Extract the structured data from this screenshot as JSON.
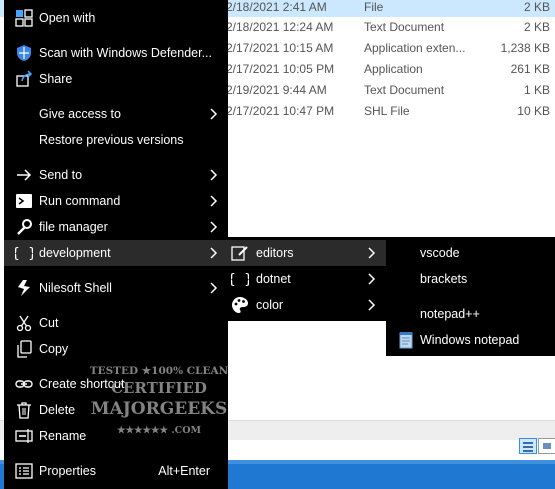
{
  "file_list": {
    "rows": [
      {
        "date": "2/18/2021 2:41 AM",
        "type": "File",
        "size": "2 KB",
        "selected": true
      },
      {
        "date": "2/18/2021 12:24 AM",
        "type": "Text Document",
        "size": "2 KB"
      },
      {
        "date": "2/17/2021 10:15 AM",
        "type": "Application exten...",
        "size": "1,238 KB"
      },
      {
        "date": "2/17/2021 10:05 PM",
        "type": "Application",
        "size": "261 KB"
      },
      {
        "date": "2/19/2021 9:44 AM",
        "type": "Text Document",
        "size": "1 KB"
      },
      {
        "date": "2/17/2021 10:47 PM",
        "type": "SHL File",
        "size": "10 KB"
      }
    ]
  },
  "context_menu": {
    "items": [
      {
        "id": "open-with",
        "label": "Open with",
        "icon": "open-with-icon"
      },
      {
        "id": "scan-defender",
        "label": "Scan with Windows Defender...",
        "icon": "windows-defender-icon"
      },
      {
        "id": "share",
        "label": "Share",
        "icon": "share-icon"
      },
      {
        "id": "give-access",
        "label": "Give access to",
        "submenu": true
      },
      {
        "id": "restore-versions",
        "label": "Restore previous versions"
      },
      {
        "id": "send-to",
        "label": "Send to",
        "icon": "arrow-right-icon",
        "submenu": true
      },
      {
        "id": "run-command",
        "label": "Run command",
        "icon": "terminal-icon",
        "submenu": true
      },
      {
        "id": "file-manager",
        "label": "file manager",
        "icon": "wrench-icon",
        "submenu": true
      },
      {
        "id": "development",
        "label": "development",
        "icon": "braces-icon",
        "submenu": true,
        "highlighted": true
      },
      {
        "id": "nilesoft-shell",
        "label": "Nilesoft Shell",
        "icon": "nilesoft-logo-icon",
        "submenu": true
      },
      {
        "id": "cut",
        "label": "Cut",
        "icon": "scissors-icon"
      },
      {
        "id": "copy",
        "label": "Copy",
        "icon": "copy-icon"
      },
      {
        "id": "create-shortcut",
        "label": "Create shortcut",
        "icon": "link-icon"
      },
      {
        "id": "delete",
        "label": "Delete",
        "icon": "trash-icon"
      },
      {
        "id": "rename",
        "label": "Rename",
        "icon": "rename-icon"
      },
      {
        "id": "properties",
        "label": "Properties",
        "icon": "properties-icon",
        "accelerator": "Alt+Enter"
      }
    ]
  },
  "development_submenu": {
    "items": [
      {
        "id": "editors",
        "label": "editors",
        "icon": "edit-icon",
        "submenu": true,
        "highlighted": true
      },
      {
        "id": "dotnet",
        "label": "dotnet",
        "icon": "braces-icon",
        "submenu": true
      },
      {
        "id": "color",
        "label": "color",
        "icon": "palette-icon",
        "submenu": true
      }
    ]
  },
  "editors_submenu": {
    "items": [
      {
        "id": "vscode",
        "label": "vscode"
      },
      {
        "id": "brackets",
        "label": "brackets"
      },
      {
        "id": "notepadpp",
        "label": "notepad++"
      },
      {
        "id": "notepad",
        "label": "Windows notepad",
        "icon": "notepad-icon"
      }
    ]
  },
  "watermark": {
    "line1": "TESTED ★100% CLEAN",
    "line2": "CERTIFIED",
    "line3": "MAJORGEEKS",
    "line4": "★★★★★★ .COM"
  },
  "colors": {
    "menu_bg": "#000000",
    "menu_highlight": "#2b2b2b",
    "selection": "#cce8ff",
    "taskbar": "#1f78d1"
  }
}
